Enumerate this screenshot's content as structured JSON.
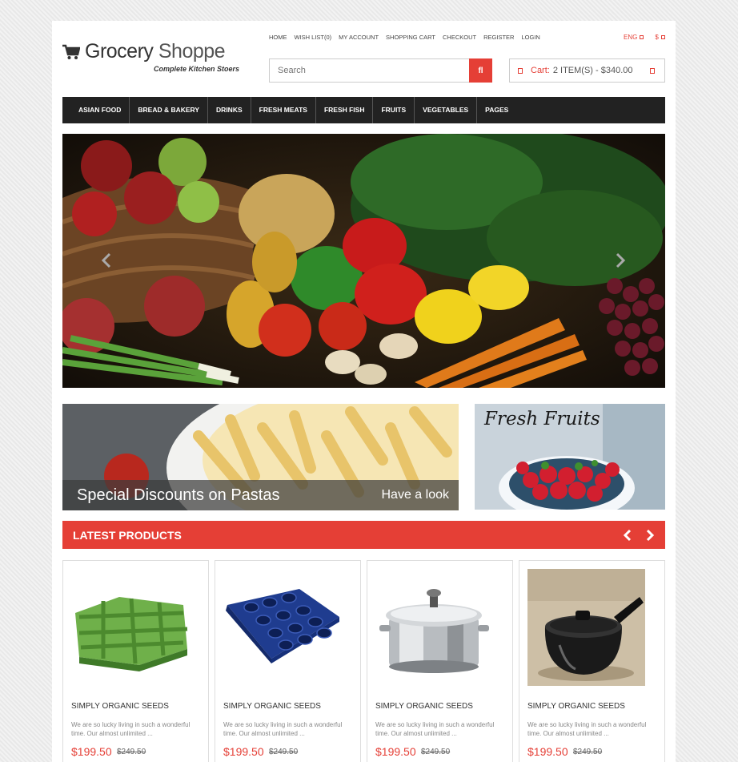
{
  "logo": {
    "title_part1": "Grocery",
    "title_part2": "Shoppe",
    "tagline": "Complete Kitchen Stoers"
  },
  "top_links": [
    "HOME",
    "WISH LIST(0)",
    "MY ACCOUNT",
    "SHOPPING CART",
    "CHECKOUT",
    "REGISTER",
    "LOGIN"
  ],
  "header": {
    "language": "ENG",
    "currency": "$"
  },
  "search": {
    "placeholder": "Search",
    "button_glyph": "fl"
  },
  "cart": {
    "label": "Cart:",
    "summary": "2 ITEM(S) - $340.00"
  },
  "nav": [
    "ASIAN FOOD",
    "BREAD & BAKERY",
    "DRINKS",
    "FRESH MEATS",
    "FRESH FISH",
    "FRUITS",
    "VEGETABLES",
    "PAGES"
  ],
  "banners": {
    "pasta_caption": "Special Discounts on Pastas",
    "pasta_link": "Have a look",
    "fruits_heading": "Fresh Fruits"
  },
  "latest": {
    "title": "LATEST PRODUCTS"
  },
  "products": [
    {
      "name": "SIMPLY ORGANIC SEEDS",
      "desc": "We are so lucky living in such a wonderful time. Our almost unlimited ...",
      "price": "$199.50",
      "old_price": "$249.50",
      "image": "green-trivet"
    },
    {
      "name": "SIMPLY ORGANIC SEEDS",
      "desc": "We are so lucky living in such a wonderful time. Our almost unlimited ...",
      "price": "$199.50",
      "old_price": "$249.50",
      "image": "muffin-pan"
    },
    {
      "name": "SIMPLY ORGANIC SEEDS",
      "desc": "We are so lucky living in such a wonderful time. Our almost unlimited ...",
      "price": "$199.50",
      "old_price": "$249.50",
      "image": "steel-stock-pot"
    },
    {
      "name": "SIMPLY ORGANIC SEEDS",
      "desc": "We are so lucky living in such a wonderful time. Our almost unlimited ...",
      "price": "$199.50",
      "old_price": "$249.50",
      "image": "black-saucepan"
    }
  ],
  "colors": {
    "accent": "#e53f36",
    "nav_bg": "#222222"
  }
}
